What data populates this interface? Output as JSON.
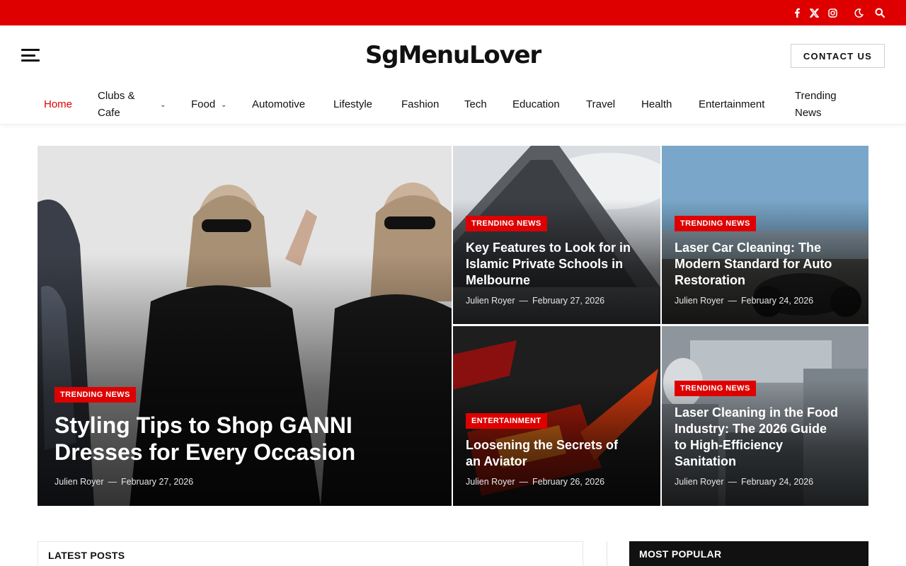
{
  "site": {
    "logo": "SgMenuLover",
    "contact_label": "CONTACT US",
    "accent_color": "#de0000"
  },
  "topbar_icons": [
    "facebook-icon",
    "x-twitter-icon",
    "instagram-icon",
    "dark-mode-icon",
    "search-icon"
  ],
  "nav": {
    "items": [
      {
        "label": "Home",
        "active": true
      },
      {
        "label": "Clubs &",
        "label2": "Cafe",
        "dropdown": true
      },
      {
        "label": "Food",
        "dropdown": true
      },
      {
        "label": "Automotive"
      },
      {
        "label": "Lifestyle"
      },
      {
        "label": "Fashion"
      },
      {
        "label": "Tech"
      },
      {
        "label": "Education"
      },
      {
        "label": "Travel"
      },
      {
        "label": "Health"
      },
      {
        "label": "Entertainment"
      },
      {
        "label": "Trending",
        "label2": "News"
      }
    ]
  },
  "featured": {
    "main": {
      "category": "TRENDING NEWS",
      "title_line1": "Styling Tips to Shop GANNI",
      "title_line2": "Dresses for Every Occasion",
      "author": "Julien Royer",
      "date": "February 27, 2026"
    },
    "cards": [
      {
        "category": "TRENDING NEWS",
        "lines": [
          "Key Features to Look for in",
          "Islamic Private Schools in",
          "Melbourne"
        ],
        "author": "Julien Royer",
        "date": "February 27, 2026"
      },
      {
        "category": "TRENDING NEWS",
        "lines": [
          "Laser Car Cleaning: The",
          "Modern Standard for Auto",
          "Restoration"
        ],
        "author": "Julien Royer",
        "date": "February 24, 2026"
      },
      {
        "category": "ENTERTAINMENT",
        "lines": [
          "Loosening the Secrets of",
          "an Aviator"
        ],
        "author": "Julien Royer",
        "date": "February 26, 2026"
      },
      {
        "category": "TRENDING NEWS",
        "lines": [
          "Laser Cleaning in the Food",
          "Industry: The 2026 Guide",
          "to High-Efficiency",
          "Sanitation"
        ],
        "author": "Julien Royer",
        "date": "February 24, 2026"
      }
    ],
    "meta_separator": "—"
  },
  "sections": {
    "latest": "LATEST POSTS",
    "popular": "MOST POPULAR"
  }
}
